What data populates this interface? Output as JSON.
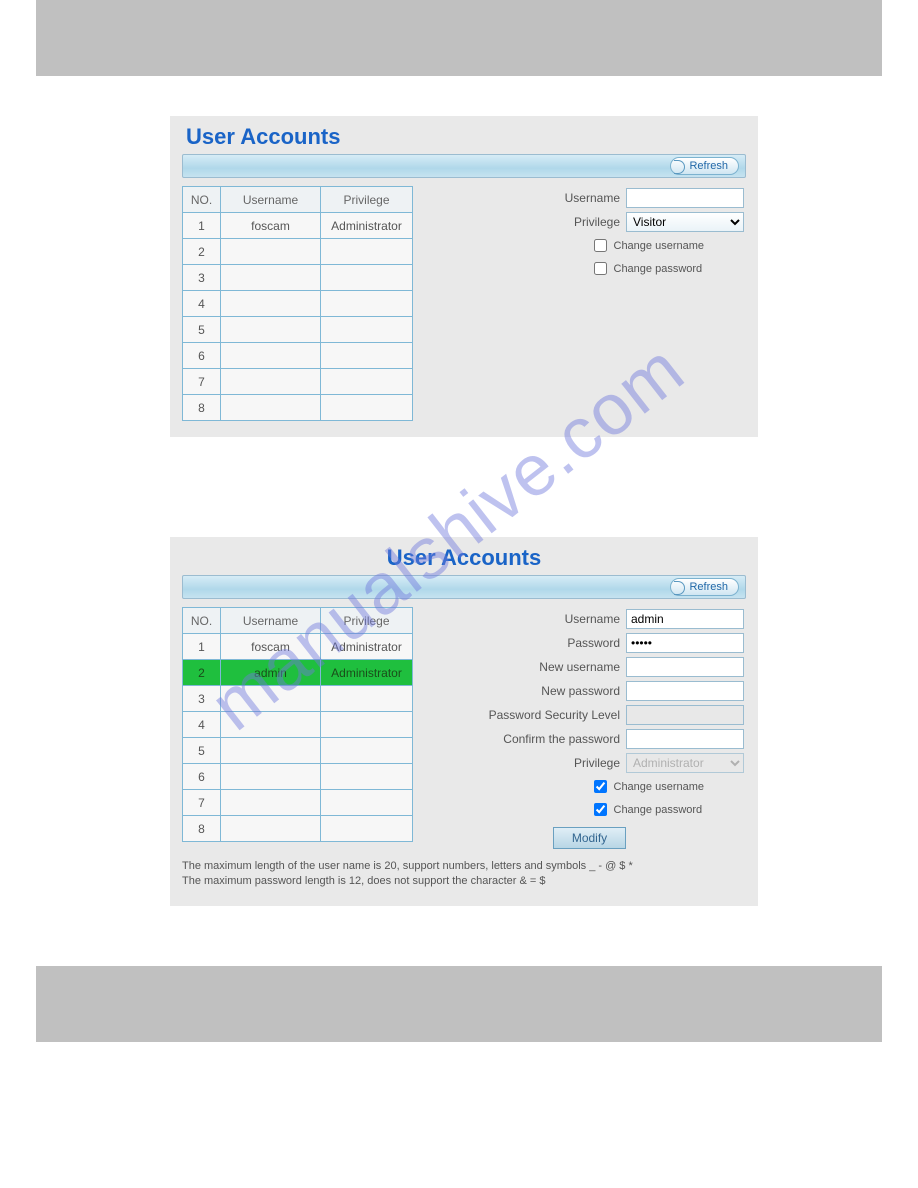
{
  "watermark": "manualshive.com",
  "panel1": {
    "title": "User Accounts",
    "refresh": "Refresh",
    "columns": {
      "no": "NO.",
      "user": "Username",
      "priv": "Privilege"
    },
    "rows": [
      {
        "no": "1",
        "user": "foscam",
        "priv": "Administrator"
      },
      {
        "no": "2",
        "user": "",
        "priv": ""
      },
      {
        "no": "3",
        "user": "",
        "priv": ""
      },
      {
        "no": "4",
        "user": "",
        "priv": ""
      },
      {
        "no": "5",
        "user": "",
        "priv": ""
      },
      {
        "no": "6",
        "user": "",
        "priv": ""
      },
      {
        "no": "7",
        "user": "",
        "priv": ""
      },
      {
        "no": "8",
        "user": "",
        "priv": ""
      }
    ],
    "form": {
      "username_label": "Username",
      "username_value": "",
      "privilege_label": "Privilege",
      "privilege_value": "Visitor",
      "change_username_label": "Change username",
      "change_password_label": "Change password",
      "change_username_checked": false,
      "change_password_checked": false
    }
  },
  "panel2": {
    "title": "User Accounts",
    "refresh": "Refresh",
    "columns": {
      "no": "NO.",
      "user": "Username",
      "priv": "Privilege"
    },
    "rows": [
      {
        "no": "1",
        "user": "foscam",
        "priv": "Administrator",
        "sel": false
      },
      {
        "no": "2",
        "user": "admin",
        "priv": "Administrator",
        "sel": true
      },
      {
        "no": "3",
        "user": "",
        "priv": "",
        "sel": false
      },
      {
        "no": "4",
        "user": "",
        "priv": "",
        "sel": false
      },
      {
        "no": "5",
        "user": "",
        "priv": "",
        "sel": false
      },
      {
        "no": "6",
        "user": "",
        "priv": "",
        "sel": false
      },
      {
        "no": "7",
        "user": "",
        "priv": "",
        "sel": false
      },
      {
        "no": "8",
        "user": "",
        "priv": "",
        "sel": false
      }
    ],
    "form": {
      "username_label": "Username",
      "username_value": "admin",
      "password_label": "Password",
      "password_value": "•••••",
      "newuser_label": "New username",
      "newuser_value": "",
      "newpass_label": "New password",
      "newpass_value": "",
      "seclevel_label": "Password Security Level",
      "seclevel_value": "",
      "confirm_label": "Confirm the password",
      "confirm_value": "",
      "privilege_label": "Privilege",
      "privilege_value": "Administrator",
      "change_username_label": "Change username",
      "change_password_label": "Change password",
      "change_username_checked": true,
      "change_password_checked": true,
      "modify_label": "Modify"
    },
    "footnote1": "The maximum length of the user name is 20, support numbers, letters and symbols _ - @ $ *",
    "footnote2": "The maximum password length is 12, does not support the character & = $"
  }
}
